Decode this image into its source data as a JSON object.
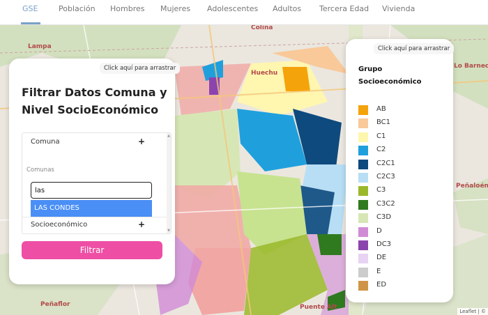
{
  "nav": {
    "tabs": [
      {
        "label": "GSE",
        "active": true
      },
      {
        "label": "Población"
      },
      {
        "label": "Hombres"
      },
      {
        "label": "Mujeres"
      },
      {
        "label": "Adolescentes"
      },
      {
        "label": "Adultos"
      },
      {
        "label": "Tercera Edad"
      },
      {
        "label": "Vivienda"
      }
    ]
  },
  "map": {
    "places": [
      "Colina",
      "Lampa",
      "Huechu",
      "Lo Barnechea",
      "Peñaloén",
      "Peñaflor",
      "Puente Alt"
    ],
    "attribution": "Leaflet | ©"
  },
  "filter_panel": {
    "drag_hint": "Click aquí para arrastrar",
    "title": "Filtrar Datos Comuna y Nivel SocioEconómico",
    "comuna_header": "Comuna",
    "comunas_label": "Comunas",
    "search_value": "las",
    "option_selected": "LAS CONDES",
    "socio_header": "Socioeconómico",
    "plus": "+",
    "filter_button": "Filtrar"
  },
  "legend_panel": {
    "drag_hint": "Click aquí para arrastrar",
    "title": "Grupo Socioeconómico",
    "items": [
      {
        "label": "AB",
        "color": "#f5a30a"
      },
      {
        "label": "BC1",
        "color": "#f9c99a"
      },
      {
        "label": "C1",
        "color": "#fdf7ad"
      },
      {
        "label": "C2",
        "color": "#1fa0dd"
      },
      {
        "label": "C2C1",
        "color": "#0e4a7e"
      },
      {
        "label": "C2C3",
        "color": "#b7def4"
      },
      {
        "label": "C3",
        "color": "#9bb82b"
      },
      {
        "label": "C3C2",
        "color": "#2f7a1f"
      },
      {
        "label": "C3D",
        "color": "#d6e7b5"
      },
      {
        "label": "D",
        "color": "#d18bd6"
      },
      {
        "label": "DC3",
        "color": "#8b44ae"
      },
      {
        "label": "DE",
        "color": "#e8d3f3"
      },
      {
        "label": "E",
        "color": "#cccccc"
      },
      {
        "label": "ED",
        "color": "#cf9547"
      }
    ]
  }
}
